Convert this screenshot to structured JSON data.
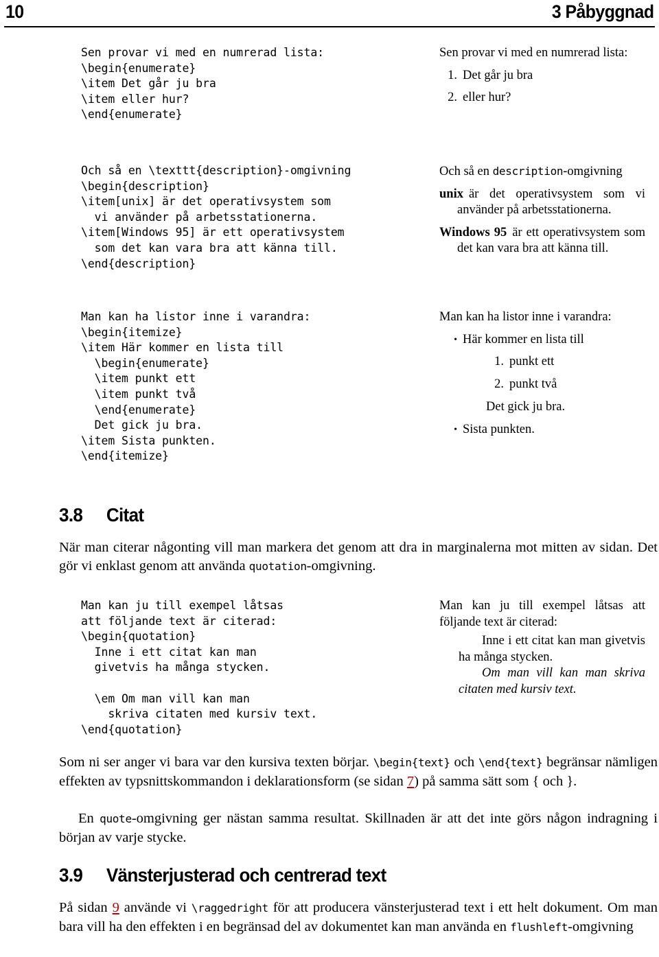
{
  "header": {
    "page_number": "10",
    "chapter_title": "3 Påbyggnad"
  },
  "examples": [
    {
      "id": "enumerate",
      "source": "Sen provar vi med en numrerad lista:\n\\begin{enumerate}\n\\item Det går ju bra\n\\item eller hur?\n\\end{enumerate}",
      "result": {
        "lead": "Sen provar vi med en numrerad lista:",
        "items": [
          {
            "mark": "1.",
            "text": "Det går ju bra"
          },
          {
            "mark": "2.",
            "text": "eller hur?"
          }
        ]
      }
    },
    {
      "id": "description",
      "source": "Och så en \\texttt{description}-omgivning\n\\begin{description}\n\\item[unix] är det operativsystem som\n  vi använder på arbetsstationerna.\n\\item[Windows 95] är ett operativsystem\n  som det kan vara bra att känna till.\n\\end{description}",
      "result": {
        "lead_before": "Och så en ",
        "lead_tt": "description",
        "lead_after": "-omgivning",
        "rows": [
          {
            "term": "unix",
            "text": "är det operativsystem som vi använder på arbetsstationerna."
          },
          {
            "term": "Windows 95",
            "text": "är ett operativsystem som det kan vara bra att känna till."
          }
        ]
      }
    },
    {
      "id": "nested-lists",
      "source": "Man kan ha listor inne i varandra:\n\\begin{itemize}\n\\item Här kommer en lista till\n  \\begin{enumerate}\n  \\item punkt ett\n  \\item punkt två\n  \\end{enumerate}\n  Det gick ju bra.\n\\item Sista punkten.\n\\end{itemize}",
      "result": {
        "lead": "Man kan ha listor inne i varandra:",
        "bullet": "•",
        "first_item": "Här kommer en lista till",
        "nested": [
          {
            "mark": "1.",
            "text": "punkt ett"
          },
          {
            "mark": "2.",
            "text": "punkt två"
          }
        ],
        "after_nested": "Det gick ju bra.",
        "last_item": "Sista punkten."
      }
    },
    {
      "id": "quotation",
      "source": "Man kan ju till exempel låtsas\natt följande text är citerad:\n\\begin{quotation}\n  Inne i ett citat kan man\n  givetvis ha många stycken.\n\n  \\em Om man vill kan man\n    skriva citaten med kursiv text.\n\\end{quotation}",
      "result": {
        "lead": "Man kan ju till exempel låtsas att följande text är citerad:",
        "quote_para_1": "Inne i ett citat kan man givetvis ha många stycken.",
        "quote_para_2": "Om man vill kan man skriva citaten med kursiv text."
      }
    }
  ],
  "sections": [
    {
      "id": "3.8",
      "number": "3.8",
      "title": "Citat",
      "intro": {
        "part1": "När man citerar någonting vill man markera det genom att dra in marginalerna mot mitten av sidan. Det gör vi enklast genom att använda ",
        "tt": "quotation",
        "part2": "-omgivning."
      },
      "after": {
        "p1_a": "Som ni ser anger vi bara var den kursiva texten börjar. ",
        "p1_tt1": "\\begin{text}",
        "p1_b": " och ",
        "p1_tt2": "\\end{text}",
        "p1_c": " begränsar nämligen effekten av typsnittskommandon i deklarationsform (se sidan ",
        "p1_link": "7",
        "p1_d": ") på samma sätt som { och }.",
        "p2_a": "En ",
        "p2_tt": "quote",
        "p2_b": "-omgivning ger nästan samma resultat. Skillnaden är att det inte görs någon indragning i början av varje stycke."
      }
    },
    {
      "id": "3.9",
      "number": "3.9",
      "title": "Vänsterjusterad och centrerad text",
      "intro": {
        "a": "På sidan ",
        "link": "9",
        "b": " använde vi ",
        "tt1": "\\raggedright",
        "c": " för att producera vänsterjusterad text i ett helt dokument. Om man bara vill ha den effekten i en begränsad del av dokumentet kan man använda en ",
        "tt2": "flushleft",
        "d": "-omgivning"
      }
    }
  ],
  "colors": {
    "link": "#c00000",
    "text": "#000000",
    "background": "#ffffff"
  }
}
